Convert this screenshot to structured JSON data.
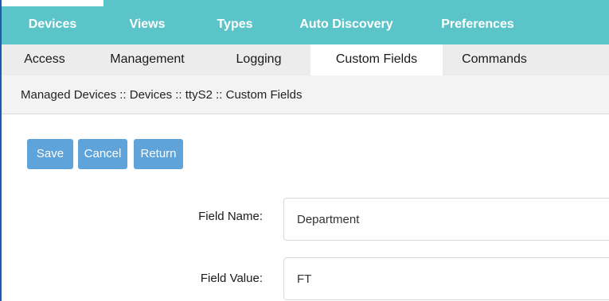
{
  "topnav": {
    "tabs": [
      "Devices",
      "Views",
      "Types",
      "Auto Discovery",
      "Preferences"
    ],
    "active": "Devices"
  },
  "subnav": {
    "tabs": [
      "Access",
      "Management",
      "Logging",
      "Custom Fields",
      "Commands"
    ],
    "active": "Custom Fields"
  },
  "breadcrumb": "Managed Devices :: Devices :: ttyS2 :: Custom Fields",
  "buttons": {
    "save": "Save",
    "cancel": "Cancel",
    "return": "Return"
  },
  "form": {
    "field_name_label": "Field Name:",
    "field_name_value": "Department",
    "field_value_label": "Field Value:",
    "field_value_value": "FT"
  },
  "colors": {
    "topnav_bg": "#5bc4c9",
    "button_bg": "#5ea3d9"
  }
}
